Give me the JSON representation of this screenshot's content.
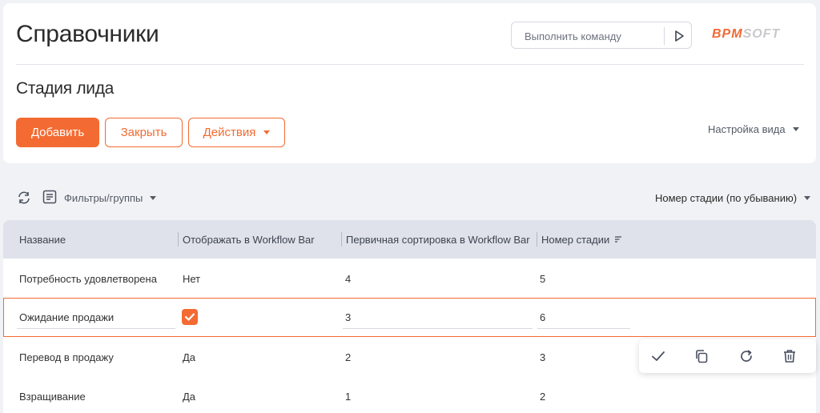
{
  "header": {
    "title": "Справочники",
    "command_placeholder": "Выполнить команду",
    "logo_part1": "BPM",
    "logo_part2": "SOFT"
  },
  "section": {
    "title": "Стадия лида"
  },
  "actions": {
    "add_label": "Добавить",
    "close_label": "Закрыть",
    "actions_label": "Действия",
    "view_settings_label": "Настройка вида"
  },
  "toolbar": {
    "filters_label": "Фильтры/группы",
    "sort_label": "Номер стадии (по убыванию)"
  },
  "grid": {
    "columns": [
      "Название",
      "Отображать в Workflow Bar",
      "Первичная сортировка в Workflow Bar",
      "Номер стадии"
    ],
    "rows": [
      {
        "name": "Потребность удовлетворена",
        "show": "Нет",
        "sort": "4",
        "stage": "5"
      },
      {
        "name": "Ожидание продажи",
        "show": "",
        "sort": "3",
        "stage": "6",
        "editing": true,
        "checked": true
      },
      {
        "name": "Перевод в продажу",
        "show": "Да",
        "sort": "2",
        "stage": "3"
      },
      {
        "name": "Взращивание",
        "show": "Да",
        "sort": "1",
        "stage": "2"
      }
    ]
  },
  "row_actions": [
    "check-icon",
    "copy-icon",
    "refresh-icon",
    "trash-icon"
  ],
  "colors": {
    "accent": "#f36b32",
    "header_bg": "#dfe2ea",
    "page_bg": "#f1f2f5"
  }
}
